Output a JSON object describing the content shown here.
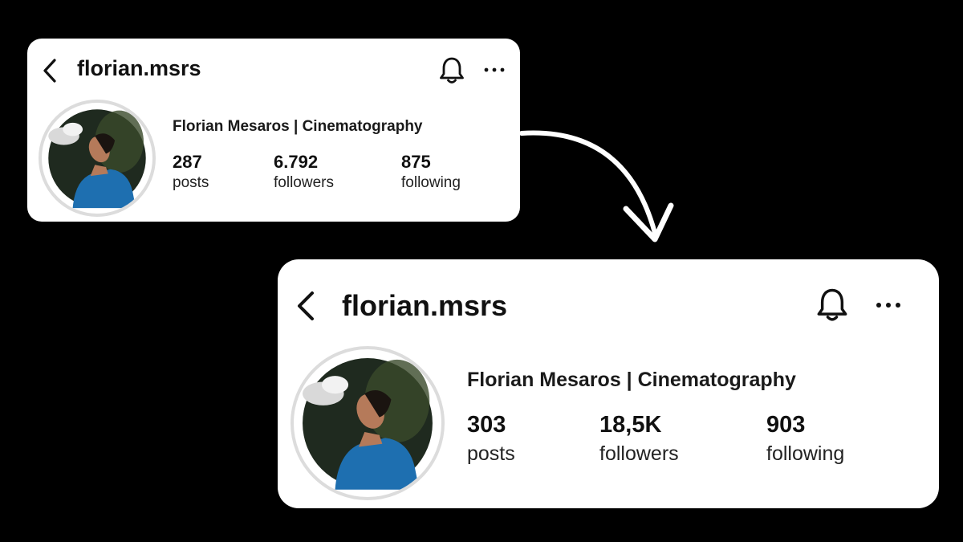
{
  "colors": {
    "background": "#000000",
    "card": "#ffffff",
    "text": "#111111",
    "ring": "#dcdcdc",
    "hoodie": "#1e6fb0"
  },
  "before": {
    "username": "florian.msrs",
    "full_name": "Florian Mesaros | Cinematography",
    "stats": [
      {
        "value": "287",
        "label": "posts"
      },
      {
        "value": "6.792",
        "label": "followers"
      },
      {
        "value": "875",
        "label": "following"
      }
    ],
    "icons": [
      "back-chevron-icon",
      "bell-icon",
      "more-icon"
    ]
  },
  "after": {
    "username": "florian.msrs",
    "full_name": "Florian Mesaros | Cinematography",
    "stats": [
      {
        "value": "303",
        "label": "posts"
      },
      {
        "value": "18,5K",
        "label": "followers"
      },
      {
        "value": "903",
        "label": "following"
      }
    ],
    "icons": [
      "back-chevron-icon",
      "bell-icon",
      "more-icon"
    ]
  },
  "connector": {
    "icon": "curved-arrow-icon"
  }
}
